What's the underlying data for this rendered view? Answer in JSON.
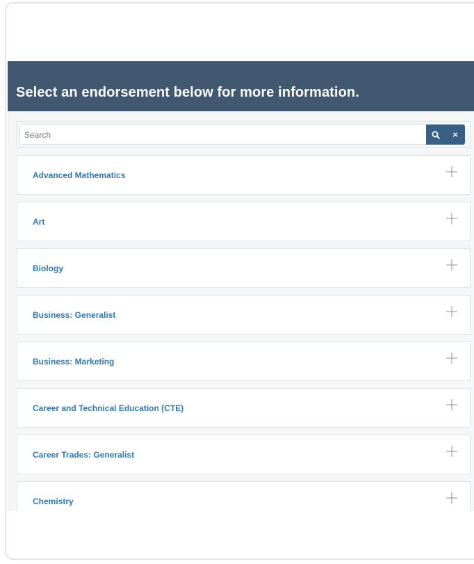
{
  "header": {
    "title": "Select an endorsement below for more information."
  },
  "search": {
    "placeholder": "Search",
    "value": "",
    "search_icon": "search-icon",
    "clear_icon": "close-icon",
    "clear_label": "×"
  },
  "items": [
    {
      "label": "Advanced Mathematics",
      "icon": "plus-icon"
    },
    {
      "label": "Art",
      "icon": "plus-icon"
    },
    {
      "label": "Biology",
      "icon": "plus-icon"
    },
    {
      "label": "Business: Generalist",
      "icon": "plus-icon"
    },
    {
      "label": "Business: Marketing",
      "icon": "plus-icon"
    },
    {
      "label": "Career and Technical Education (CTE)",
      "icon": "plus-icon"
    },
    {
      "label": "Career Trades: Generalist",
      "icon": "plus-icon"
    },
    {
      "label": "Chemistry",
      "icon": "plus-icon"
    }
  ],
  "colors": {
    "header_bg": "#425870",
    "accent_button": "#3a5f85",
    "link_text": "#2f78b4"
  }
}
